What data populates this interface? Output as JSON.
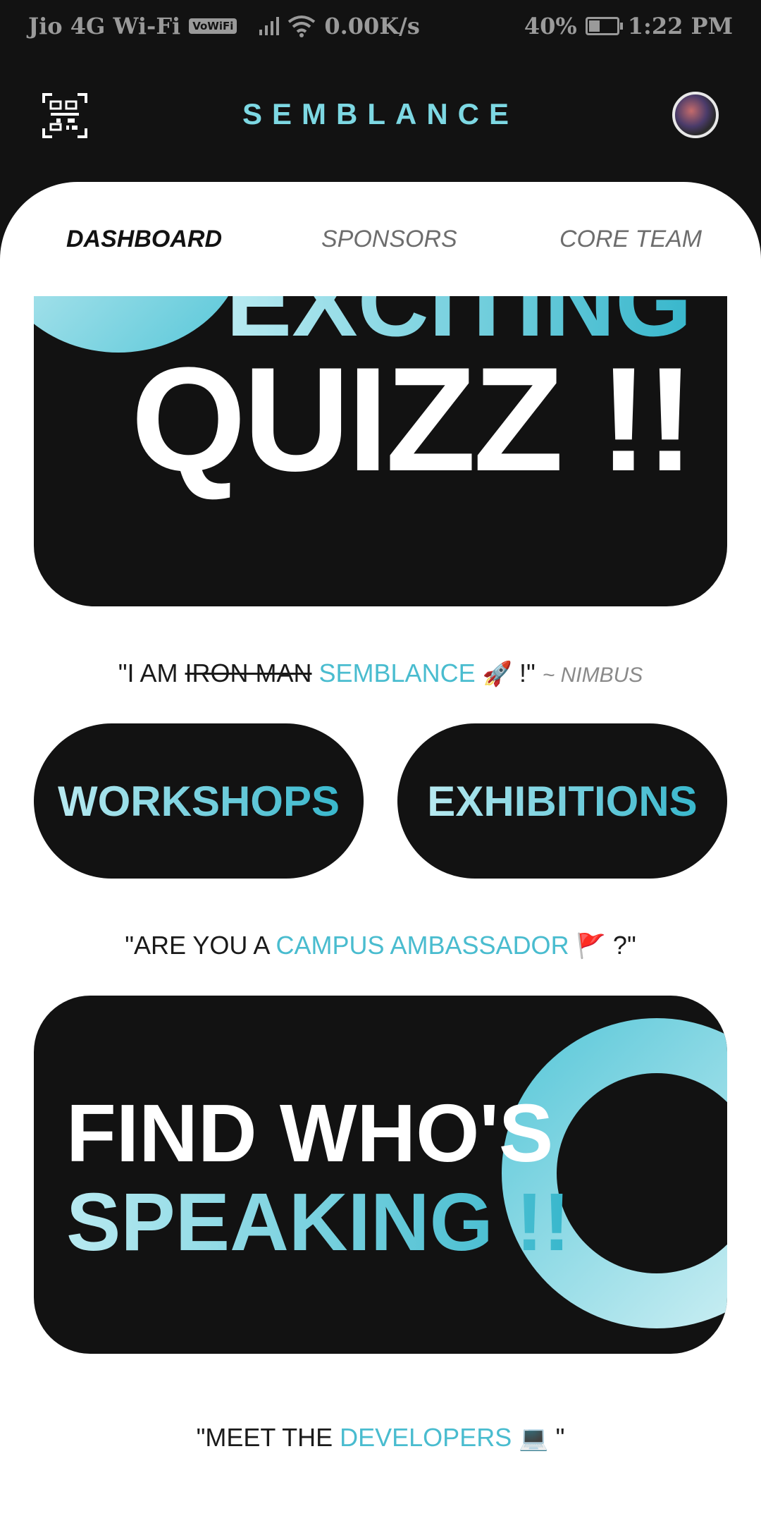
{
  "status_bar": {
    "carrier": "Jio 4G Wi-Fi",
    "vowifi": "VoWiFi",
    "speed": "0.00K/s",
    "battery": "40%",
    "battery_level": 0.4,
    "time": "1:22 PM"
  },
  "header": {
    "title": "SEMBLANCE",
    "qr_icon": "qr-code-icon",
    "avatar_icon": "user-avatar"
  },
  "tabs": [
    {
      "label": "DASHBOARD",
      "active": true
    },
    {
      "label": "SPONSORS",
      "active": false
    },
    {
      "label": "CORE TEAM",
      "active": false
    }
  ],
  "quiz_card": {
    "line1": "EXCITING",
    "line2": "QUIZZ !!"
  },
  "quote_iron": {
    "prefix": "\"I AM ",
    "struck": "IRON MAN",
    "highlight": "SEMBLANCE",
    "emoji": "🚀",
    "suffix": " !\"",
    "author": "~ NIMBUS"
  },
  "buttons": {
    "workshops": "WORKSHOPS",
    "exhibitions": "EXHIBITIONS"
  },
  "quote_ambassador": {
    "prefix": "\"ARE YOU A ",
    "highlight": "CAMPUS AMBASSADOR",
    "emoji": "🚩",
    "suffix": " ?\""
  },
  "speaker_card": {
    "line1": "FIND WHO'S",
    "line2": "SPEAKING !!"
  },
  "quote_developers": {
    "prefix": "\"MEET THE ",
    "highlight": "DEVELOPERS",
    "emoji": "💻",
    "suffix": " \""
  },
  "colors": {
    "dark": "#121212",
    "accent": "#49bccf",
    "accent_light": "#b8eaf1"
  }
}
